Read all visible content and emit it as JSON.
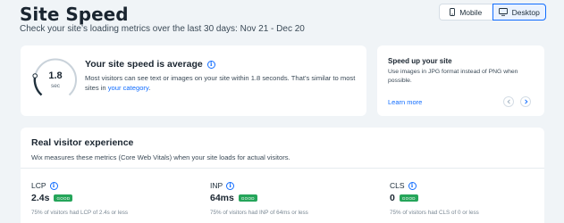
{
  "header": {
    "title": "Site Speed",
    "subtitle": "Check your site’s loading metrics over the last 30 days: Nov 21 - Dec 20"
  },
  "device_toggle": {
    "options": [
      {
        "label": "Mobile",
        "icon": "mobile-icon",
        "selected": false
      },
      {
        "label": "Desktop",
        "icon": "desktop-icon",
        "selected": true
      }
    ]
  },
  "speed_card": {
    "gauge_value": "1.8",
    "gauge_unit": "sec",
    "heading": "Your site speed is average",
    "body_text": "Most visitors can see text or images on your site within 1.8 seconds. That’s similar to most sites in ",
    "body_link": "your category",
    "body_end": "."
  },
  "tip_card": {
    "heading": "Speed up your site",
    "body": "Use images in JPG format instead of PNG when possible.",
    "link": "Learn more",
    "prev_icon": "chevron-left-icon",
    "next_icon": "chevron-right-icon"
  },
  "experience": {
    "heading": "Real visitor experience",
    "subtitle": "Wix measures these metrics (Core Web Vitals) when your site loads for actual visitors.",
    "metrics": [
      {
        "name": "LCP",
        "value": "2.4s",
        "badge": "GOOD",
        "desc": "75% of visitors had LCP of 2.4s or less"
      },
      {
        "name": "INP",
        "value": "64ms",
        "badge": "GOOD",
        "desc": "75% of visitors had INP of 64ms or less"
      },
      {
        "name": "CLS",
        "value": "0",
        "badge": "GOOD",
        "desc": "75% of visitors had CLS of 0 or less"
      }
    ]
  },
  "colors": {
    "accent": "#116dff",
    "good": "#25a55a",
    "background": "#f0f4f7"
  }
}
